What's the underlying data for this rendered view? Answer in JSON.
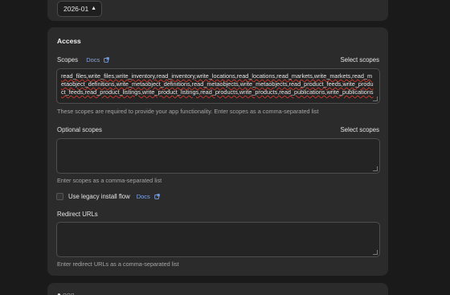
{
  "version_select": {
    "value": "2026-01"
  },
  "access": {
    "title": "Access",
    "scopes": {
      "label": "Scopes",
      "docs_label": "Docs",
      "select_label": "Select scopes",
      "value": "read_files,write_files,write_inventory,read_inventory,write_locations,read_locations,read_markets,write_markets,read_metaobject_definitions,write_metaobject_definitions,read_metaobjects,write_metaobjects,read_product_feeds,write_product_feeds,read_product_listings,write_product_listings,read_products,write_products,read_publications,write_publications",
      "help": "These scopes are required to provide your app functionality. Enter scopes as a comma-separated list"
    },
    "optional_scopes": {
      "label": "Optional scopes",
      "select_label": "Select scopes",
      "value": "",
      "help": "Enter scopes as a comma-separated list"
    },
    "legacy_install": {
      "label": "Use legacy install flow",
      "docs_label": "Docs",
      "checked": false
    },
    "redirect_urls": {
      "label": "Redirect URLs",
      "value": "",
      "help": "Enter redirect URLs as a comma-separated list"
    }
  },
  "next_section": {
    "title_fragment": "● ○○○"
  },
  "colors": {
    "background": "#1a1a1a",
    "card": "#2b2b2b",
    "link": "#7ea6f0",
    "spell_error": "#c0392b"
  }
}
